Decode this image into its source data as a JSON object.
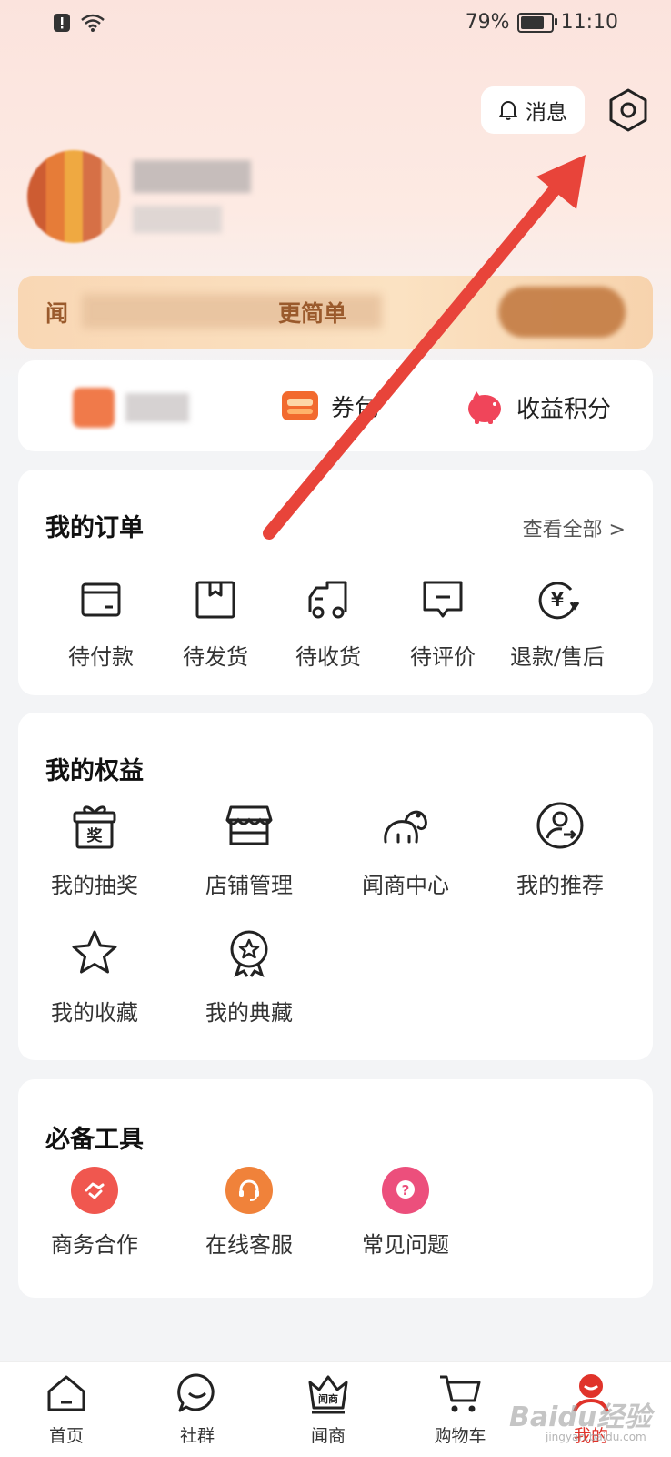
{
  "status_bar": {
    "battery": "79%",
    "time": "11:10",
    "battery_level": 0.79
  },
  "header": {
    "message_label": "消息"
  },
  "promo": {
    "text_visible": "闻",
    "text_tail": "更简单"
  },
  "quick_bar": {
    "coupon_label": "券包",
    "points_label": "收益积分"
  },
  "orders": {
    "title": "我的订单",
    "see_all": "查看全部 >",
    "items": [
      {
        "label": "待付款",
        "icon": "wallet-card-icon"
      },
      {
        "label": "待发货",
        "icon": "package-box-icon"
      },
      {
        "label": "待收货",
        "icon": "delivery-truck-icon"
      },
      {
        "label": "待评价",
        "icon": "review-message-icon"
      },
      {
        "label": "退款/售后",
        "icon": "refund-yuan-icon"
      }
    ]
  },
  "benefits": {
    "title": "我的权益",
    "items": [
      {
        "label": "我的抽奖",
        "icon": "lottery-gift-icon",
        "gift_char": "奖"
      },
      {
        "label": "店铺管理",
        "icon": "store-icon"
      },
      {
        "label": "闻商中心",
        "icon": "elephant-icon"
      },
      {
        "label": "我的推荐",
        "icon": "user-share-icon"
      },
      {
        "label": "我的收藏",
        "icon": "star-icon"
      },
      {
        "label": "我的典藏",
        "icon": "medal-star-icon"
      }
    ]
  },
  "tools": {
    "title": "必备工具",
    "items": [
      {
        "label": "商务合作",
        "icon": "handshake-icon",
        "color": "#f0574f"
      },
      {
        "label": "在线客服",
        "icon": "headset-icon",
        "color": "#f0823a"
      },
      {
        "label": "常见问题",
        "icon": "question-icon",
        "color": "#ec4f7c"
      }
    ]
  },
  "tabbar": {
    "items": [
      {
        "label": "首页",
        "icon": "home-icon"
      },
      {
        "label": "社群",
        "icon": "chat-bubble-icon"
      },
      {
        "label": "闻商",
        "icon": "crown-icon",
        "badge_text": "闻商"
      },
      {
        "label": "购物车",
        "icon": "cart-icon"
      },
      {
        "label": "我的",
        "icon": "profile-icon",
        "active": true
      }
    ]
  },
  "watermark": {
    "text": "Baidu经验",
    "sub": "jingyan.baidu.com"
  },
  "colors": {
    "accent_red": "#e0332a",
    "arrow_red": "#e8443a"
  }
}
